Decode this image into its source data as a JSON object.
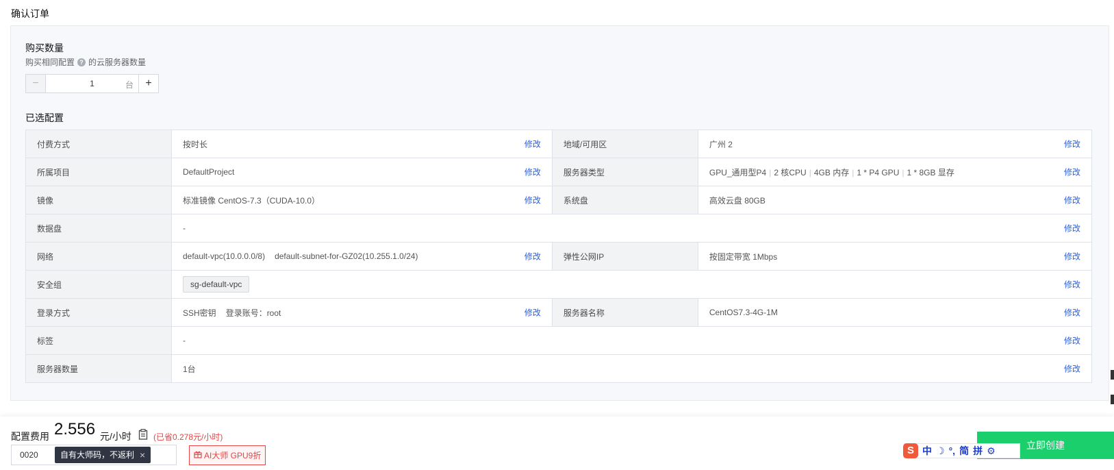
{
  "page": {
    "title": "确认订单"
  },
  "quantity": {
    "title": "购买数量",
    "desc_before": "购买相同配置",
    "help_glyph": "?",
    "desc_after": "的云服务器数量",
    "minus": "−",
    "value": "1",
    "unit": "台",
    "plus": "+"
  },
  "config": {
    "title": "已选配置",
    "edit_label": "修改",
    "rows": {
      "billing": {
        "label": "付费方式",
        "value": "按时长"
      },
      "region": {
        "label": "地域/可用区",
        "value": "广州 2"
      },
      "project": {
        "label": "所属项目",
        "value": "DefaultProject"
      },
      "server_type": {
        "label": "服务器类型",
        "parts": [
          "GPU_通用型P4",
          "2 核CPU",
          "4GB 内存",
          "1 * P4 GPU",
          "1 * 8GB 显存"
        ],
        "separator": "|"
      },
      "image": {
        "label": "镜像",
        "value": "标准镜像 CentOS-7.3（CUDA-10.0）"
      },
      "system_disk": {
        "label": "系统盘",
        "value": "高效云盘 80GB"
      },
      "data_disk": {
        "label": "数据盘",
        "value": "-"
      },
      "network": {
        "label": "网络",
        "vpc": "default-vpc(10.0.0.0/8)",
        "subnet": "default-subnet-for-GZ02(10.255.1.0/24)"
      },
      "eip": {
        "label": "弹性公网IP",
        "value": "按固定带宽 1Mbps"
      },
      "security_group": {
        "label": "安全组",
        "value": "sg-default-vpc"
      },
      "login": {
        "label": "登录方式",
        "method": "SSH密钥",
        "account": "登录账号：root"
      },
      "server_name": {
        "label": "服务器名称",
        "value": "CentOS7.3-4G-1M"
      },
      "tags": {
        "label": "标签",
        "value": "-"
      },
      "server_count": {
        "label": "服务器数量",
        "value": "1台"
      }
    }
  },
  "footer": {
    "fee_label": "配置费用",
    "fee_value": "2.556",
    "fee_unit": "元/小时",
    "saved": "(已省0.278元/小时)",
    "code_value": "0020",
    "tooltip": "自有大师码，不返利",
    "tooltip_close": "×",
    "promo": "AI大师 GPU9折",
    "create_button": "立即创建"
  },
  "ime": {
    "logo": "S",
    "items": [
      "中",
      "☽",
      "°,",
      "简",
      "拼",
      "⚙"
    ]
  },
  "colors": {
    "accent_link": "#2b5fd9",
    "create_green": "#1bcf6c",
    "price_red": "#e54545"
  }
}
